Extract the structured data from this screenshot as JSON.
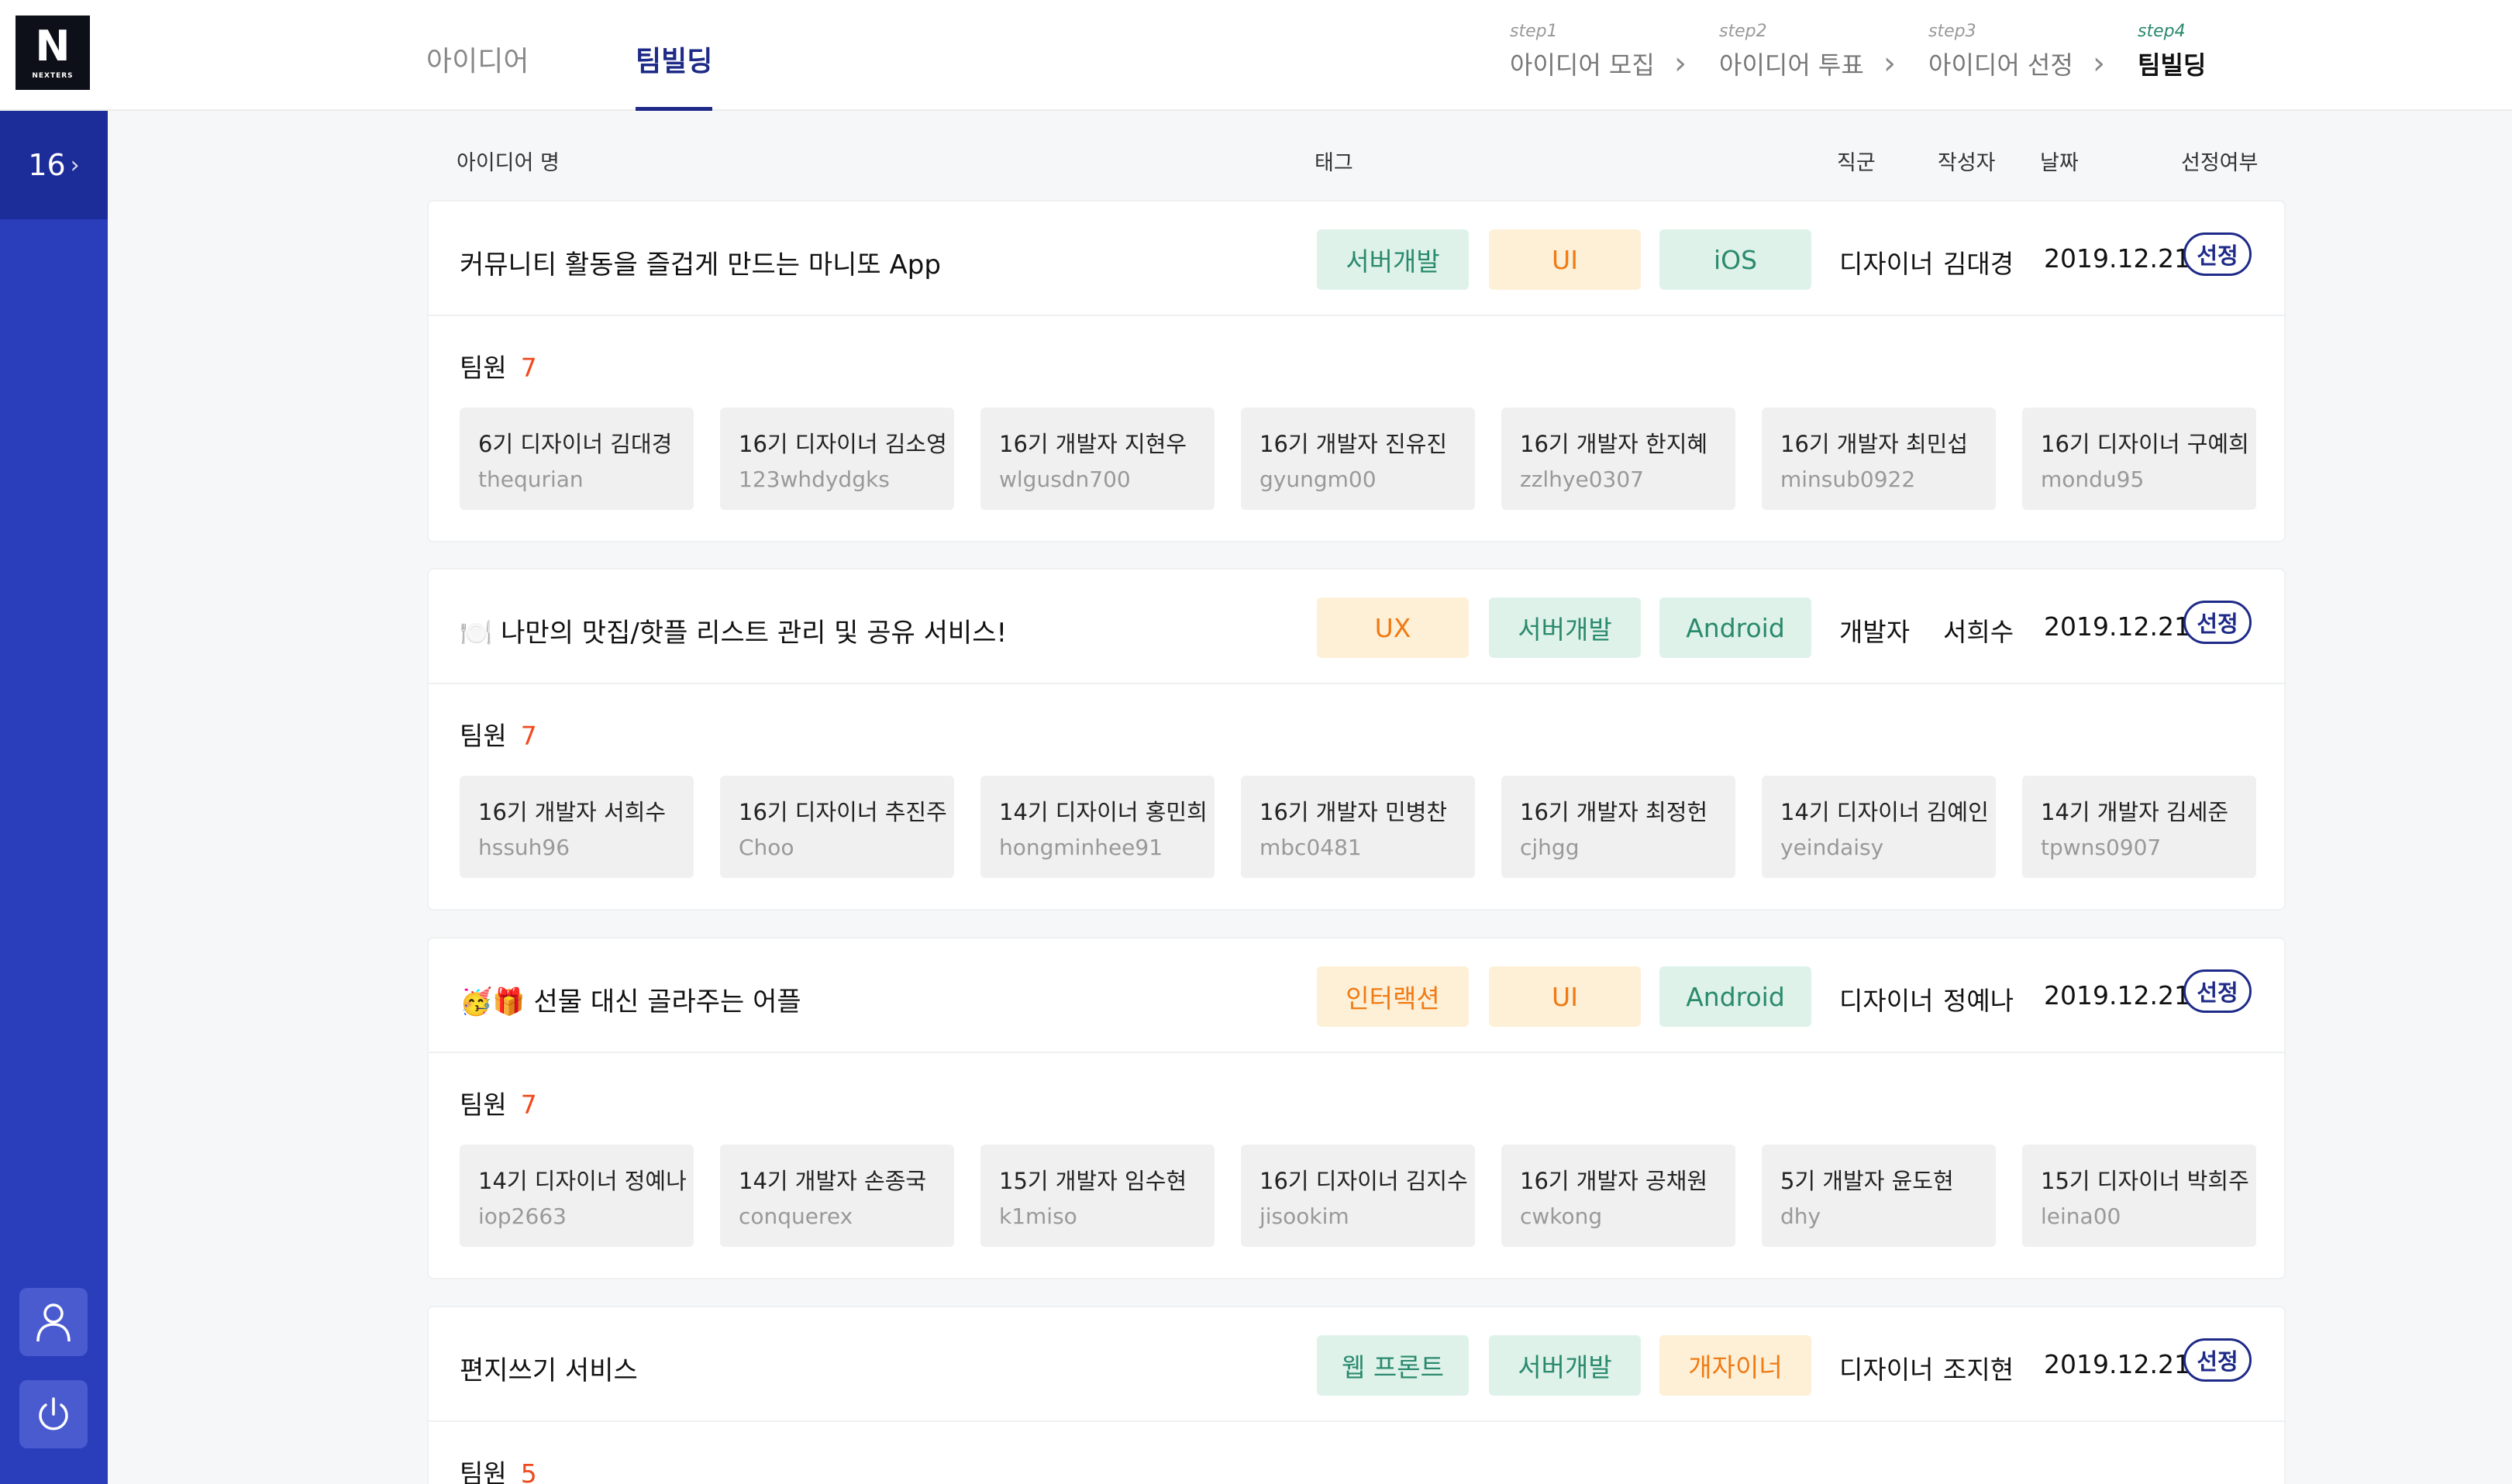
{
  "brand": {
    "mark": "N",
    "word": "NEXTERS"
  },
  "tabs": [
    "아이디어",
    "팀빌딩"
  ],
  "active_tab": "팀빌딩",
  "steps": [
    {
      "num": "step1",
      "name": "아이디어 모집"
    },
    {
      "num": "step2",
      "name": "아이디어 투표"
    },
    {
      "num": "step3",
      "name": "아이디어 선정"
    },
    {
      "num": "step4",
      "name": "팀빌딩"
    }
  ],
  "sidebar": {
    "generation": "16",
    "chevron": "›",
    "icons": [
      "user-icon",
      "power-icon"
    ]
  },
  "columns": [
    "아이디어 명",
    "태그",
    "직군",
    "작성자",
    "날짜",
    "선정여부"
  ],
  "colors": {
    "primary": "#2a3dbb",
    "dark_primary": "#1e2a88",
    "green_tag_bg": "#dff2ea",
    "green_tag_text": "#2a8a6e",
    "orange_tag_bg": "#fdf0d6",
    "orange_tag_text": "#f07a14",
    "count": "#f04a1e"
  },
  "members_label": "팀원",
  "cards": [
    {
      "title": "커뮤니티 활동을 즐겁게 만드는 마니또 App",
      "tags": [
        {
          "label": "서버개발",
          "style": "green"
        },
        {
          "label": "UI",
          "style": "orange"
        },
        {
          "label": "iOS",
          "style": "green"
        }
      ],
      "role": "디자이너",
      "author": "김대경",
      "date": "2019.12.21",
      "status": "선정",
      "member_count": "7",
      "members": [
        {
          "name": "6기 디자이너 김대경",
          "id": "thequrian"
        },
        {
          "name": "16기 디자이너 김소영",
          "id": "123whdydgks"
        },
        {
          "name": "16기 개발자 지현우",
          "id": "wlgusdn700"
        },
        {
          "name": "16기 개발자 진유진",
          "id": "gyungm00"
        },
        {
          "name": "16기 개발자 한지혜",
          "id": "zzlhye0307"
        },
        {
          "name": "16기 개발자 최민섭",
          "id": "minsub0922"
        },
        {
          "name": "16기 디자이너 구예희",
          "id": "mondu95"
        }
      ]
    },
    {
      "title": "🍽️ 나만의 맛집/핫플 리스트 관리 및 공유 서비스!",
      "tags": [
        {
          "label": "UX",
          "style": "orange"
        },
        {
          "label": "서버개발",
          "style": "green"
        },
        {
          "label": "Android",
          "style": "green"
        }
      ],
      "role": "개발자",
      "author": "서희수",
      "date": "2019.12.21",
      "status": "선정",
      "member_count": "7",
      "members": [
        {
          "name": "16기 개발자 서희수",
          "id": "hssuh96"
        },
        {
          "name": "16기 디자이너 추진주",
          "id": "Choo"
        },
        {
          "name": "14기 디자이너 홍민희",
          "id": "hongminhee91"
        },
        {
          "name": "16기 개발자 민병찬",
          "id": "mbc0481"
        },
        {
          "name": "16기 개발자 최정헌",
          "id": "cjhgg"
        },
        {
          "name": "14기 디자이너 김예인",
          "id": "yeindaisy"
        },
        {
          "name": "14기 개발자 김세준",
          "id": "tpwns0907"
        }
      ]
    },
    {
      "title": "🥳🎁 선물 대신 골라주는 어플",
      "tags": [
        {
          "label": "인터랙션",
          "style": "orange"
        },
        {
          "label": "UI",
          "style": "orange"
        },
        {
          "label": "Android",
          "style": "green"
        }
      ],
      "role": "디자이너",
      "author": "정예나",
      "date": "2019.12.21",
      "status": "선정",
      "member_count": "7",
      "members": [
        {
          "name": "14기 디자이너 정예나",
          "id": "iop2663"
        },
        {
          "name": "14기 개발자 손종국",
          "id": "conquerex"
        },
        {
          "name": "15기 개발자 임수현",
          "id": "k1miso"
        },
        {
          "name": "16기 디자이너 김지수",
          "id": "jisookim"
        },
        {
          "name": "16기 개발자 공채원",
          "id": "cwkong"
        },
        {
          "name": "5기 개발자 윤도현",
          "id": "dhy"
        },
        {
          "name": "15기 디자이너 박희주",
          "id": "leina00"
        }
      ]
    },
    {
      "title": "편지쓰기 서비스",
      "tags": [
        {
          "label": "웹 프론트",
          "style": "green"
        },
        {
          "label": "서버개발",
          "style": "green"
        },
        {
          "label": "개자이너",
          "style": "orange"
        }
      ],
      "role": "디자이너",
      "author": "조지현",
      "date": "2019.12.21",
      "status": "선정",
      "member_count": "5",
      "members": []
    }
  ]
}
